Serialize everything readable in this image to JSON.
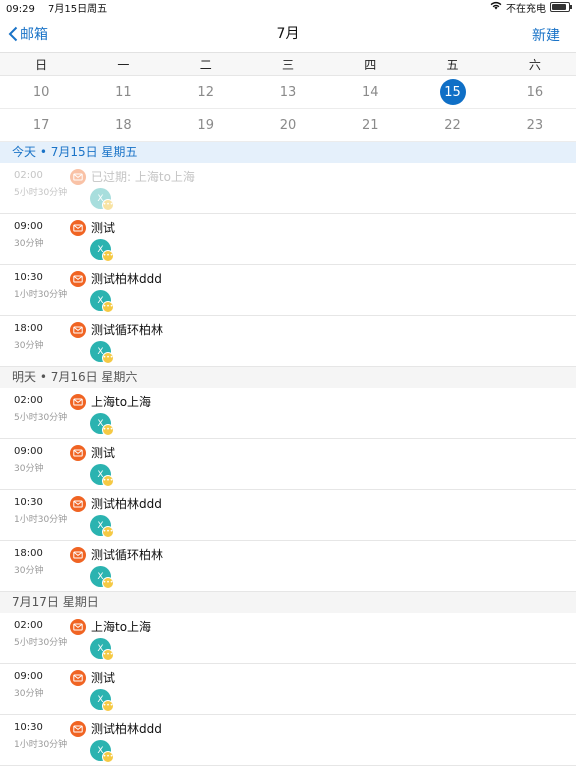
{
  "status": {
    "time": "09:29",
    "date": "7月15日周五",
    "charging": "不在充电",
    "battery_level": 0.85
  },
  "nav": {
    "back_label": "邮箱",
    "title": "7月",
    "new_label": "新建"
  },
  "calendar": {
    "weekdays": [
      "日",
      "一",
      "二",
      "三",
      "四",
      "五",
      "六"
    ],
    "weeks": [
      [
        "10",
        "11",
        "12",
        "13",
        "14",
        "15",
        "16"
      ],
      [
        "17",
        "18",
        "19",
        "20",
        "21",
        "22",
        "23"
      ]
    ],
    "selected": "15"
  },
  "sections": [
    {
      "header": "今天 • 7月15日 星期五",
      "is_today": true,
      "events": [
        {
          "time": "02:00",
          "duration": "5小时30分钟",
          "title": "已过期: 上海to上海",
          "avatar": "X",
          "expired": true
        },
        {
          "time": "09:00",
          "duration": "30分钟",
          "title": "测试",
          "avatar": "X",
          "expired": false
        },
        {
          "time": "10:30",
          "duration": "1小时30分钟",
          "title": "测试柏林ddd",
          "avatar": "X",
          "expired": false
        },
        {
          "time": "18:00",
          "duration": "30分钟",
          "title": "测试循环柏林",
          "avatar": "X",
          "expired": false
        }
      ]
    },
    {
      "header": "明天 • 7月16日 星期六",
      "is_today": false,
      "events": [
        {
          "time": "02:00",
          "duration": "5小时30分钟",
          "title": "上海to上海",
          "avatar": "X",
          "expired": false
        },
        {
          "time": "09:00",
          "duration": "30分钟",
          "title": "测试",
          "avatar": "X",
          "expired": false
        },
        {
          "time": "10:30",
          "duration": "1小时30分钟",
          "title": "测试柏林ddd",
          "avatar": "X",
          "expired": false
        },
        {
          "time": "18:00",
          "duration": "30分钟",
          "title": "测试循环柏林",
          "avatar": "X",
          "expired": false
        }
      ]
    },
    {
      "header": "7月17日 星期日",
      "is_today": false,
      "events": [
        {
          "time": "02:00",
          "duration": "5小时30分钟",
          "title": "上海to上海",
          "avatar": "X",
          "expired": false
        },
        {
          "time": "09:00",
          "duration": "30分钟",
          "title": "测试",
          "avatar": "X",
          "expired": false
        },
        {
          "time": "10:30",
          "duration": "1小时30分钟",
          "title": "测试柏林ddd",
          "avatar": "X",
          "expired": false
        }
      ]
    }
  ],
  "colors": {
    "accent": "#1a73c7",
    "mail_icon": "#f06423",
    "avatar": "#2bb3b0",
    "badge": "#f5c944",
    "today_header": "#e5f0fb"
  },
  "icons": {
    "event": "mail-icon",
    "back": "chevron-left-icon",
    "wifi": "wifi-icon",
    "battery": "battery-icon"
  }
}
